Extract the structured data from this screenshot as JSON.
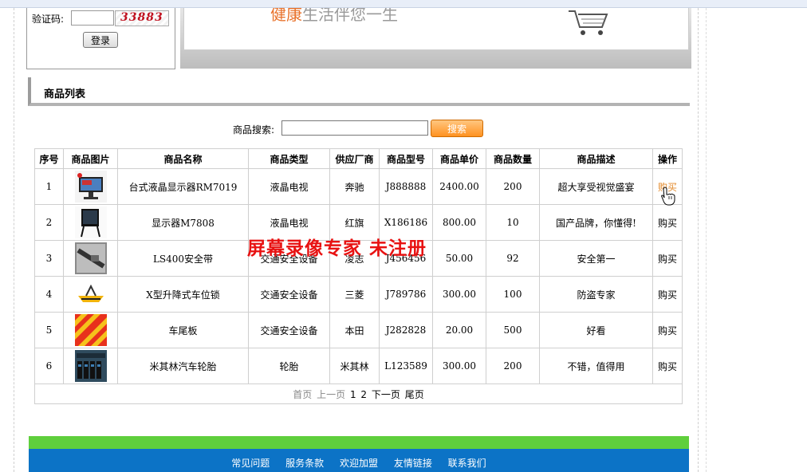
{
  "login": {
    "captcha_label": "验证码:",
    "captcha_value": "",
    "captcha_code": "33883",
    "login_button": "登录"
  },
  "banner": {
    "slogan": "健康生活伴您一生"
  },
  "section": {
    "title": "商品列表"
  },
  "search": {
    "label": "商品搜索:",
    "value": "",
    "button": "搜索"
  },
  "table": {
    "headers": [
      "序号",
      "商品图片",
      "商品名称",
      "商品类型",
      "供应厂商",
      "商品型号",
      "商品单价",
      "商品数量",
      "商品描述",
      "操作"
    ],
    "rows": [
      {
        "no": "1",
        "image": "monitor-image",
        "name": "台式液晶显示器RM7019",
        "type": "液晶电视",
        "vendor": "奔驰",
        "model": "J888888",
        "price": "2400.00",
        "qty": "200",
        "desc": "超大享受视觉盛宴",
        "op": "购买"
      },
      {
        "no": "2",
        "image": "display-image",
        "name": "显示器M7808",
        "type": "液晶电视",
        "vendor": "红旗",
        "model": "X186186",
        "price": "800.00",
        "qty": "10",
        "desc": "国产品牌，你懂得!",
        "op": "购买"
      },
      {
        "no": "3",
        "image": "seatbelt-image",
        "name": "LS400安全带",
        "type": "交通安全设备",
        "vendor": "凌志",
        "model": "J456456",
        "price": "50.00",
        "qty": "92",
        "desc": "安全第一",
        "op": "购买"
      },
      {
        "no": "4",
        "image": "parking-lock-image",
        "name": "X型升降式车位锁",
        "type": "交通安全设备",
        "vendor": "三菱",
        "model": "J789786",
        "price": "300.00",
        "qty": "100",
        "desc": "防盗专家",
        "op": "购买"
      },
      {
        "no": "5",
        "image": "rear-plate-image",
        "name": "车尾板",
        "type": "交通安全设备",
        "vendor": "本田",
        "model": "J282828",
        "price": "20.00",
        "qty": "500",
        "desc": "好看",
        "op": "购买"
      },
      {
        "no": "6",
        "image": "tire-image",
        "name": "米其林汽车轮胎",
        "type": "轮胎",
        "vendor": "米其林",
        "model": "L123589",
        "price": "300.00",
        "qty": "200",
        "desc": "不错，值得用",
        "op": "购买"
      }
    ]
  },
  "pager": {
    "first": "首页",
    "prev": "上一页",
    "page1": "1",
    "page2": "2",
    "next": "下一页",
    "last": "尾页"
  },
  "watermark": "屏幕录像专家  未注册",
  "footer": {
    "links": [
      "常见问题",
      "服务条款",
      "欢迎加盟",
      "友情链接",
      "联系我们"
    ]
  },
  "colors": {
    "accent_orange": "#ff9221",
    "footer_green": "#5fcf3c",
    "footer_blue": "#0c73c6",
    "watermark_red": "#e81212"
  }
}
